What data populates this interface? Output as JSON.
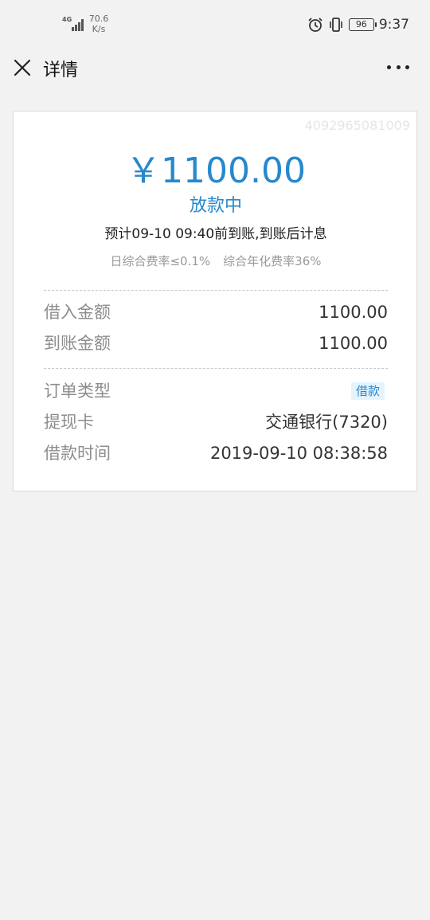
{
  "status_bar": {
    "network_label": "4G",
    "speed_value": "70.6",
    "speed_unit": "K/s",
    "battery": "96",
    "time": "9:37"
  },
  "navbar": {
    "title": "详情"
  },
  "loan": {
    "order_no": "4092965081009",
    "amount": "￥1100.00",
    "status": "放款中",
    "eta": "预计09-10 09:40前到账,到账后计息",
    "daily_rate": "日综合费率≤0.1%",
    "annual_rate": "综合年化费率36%"
  },
  "details": {
    "borrow_amount_label": "借入金额",
    "borrow_amount_value": "1100.00",
    "received_amount_label": "到账金额",
    "received_amount_value": "1100.00",
    "order_type_label": "订单类型",
    "order_type_value": "借款",
    "card_label": "提现卡",
    "card_value": "交通银行(7320)",
    "time_label": "借款时间",
    "time_value": "2019-09-10 08:38:58"
  },
  "colors": {
    "accent": "#2689cd",
    "badge_bg": "#e6f3fd",
    "page_bg": "#f2f2f2"
  }
}
